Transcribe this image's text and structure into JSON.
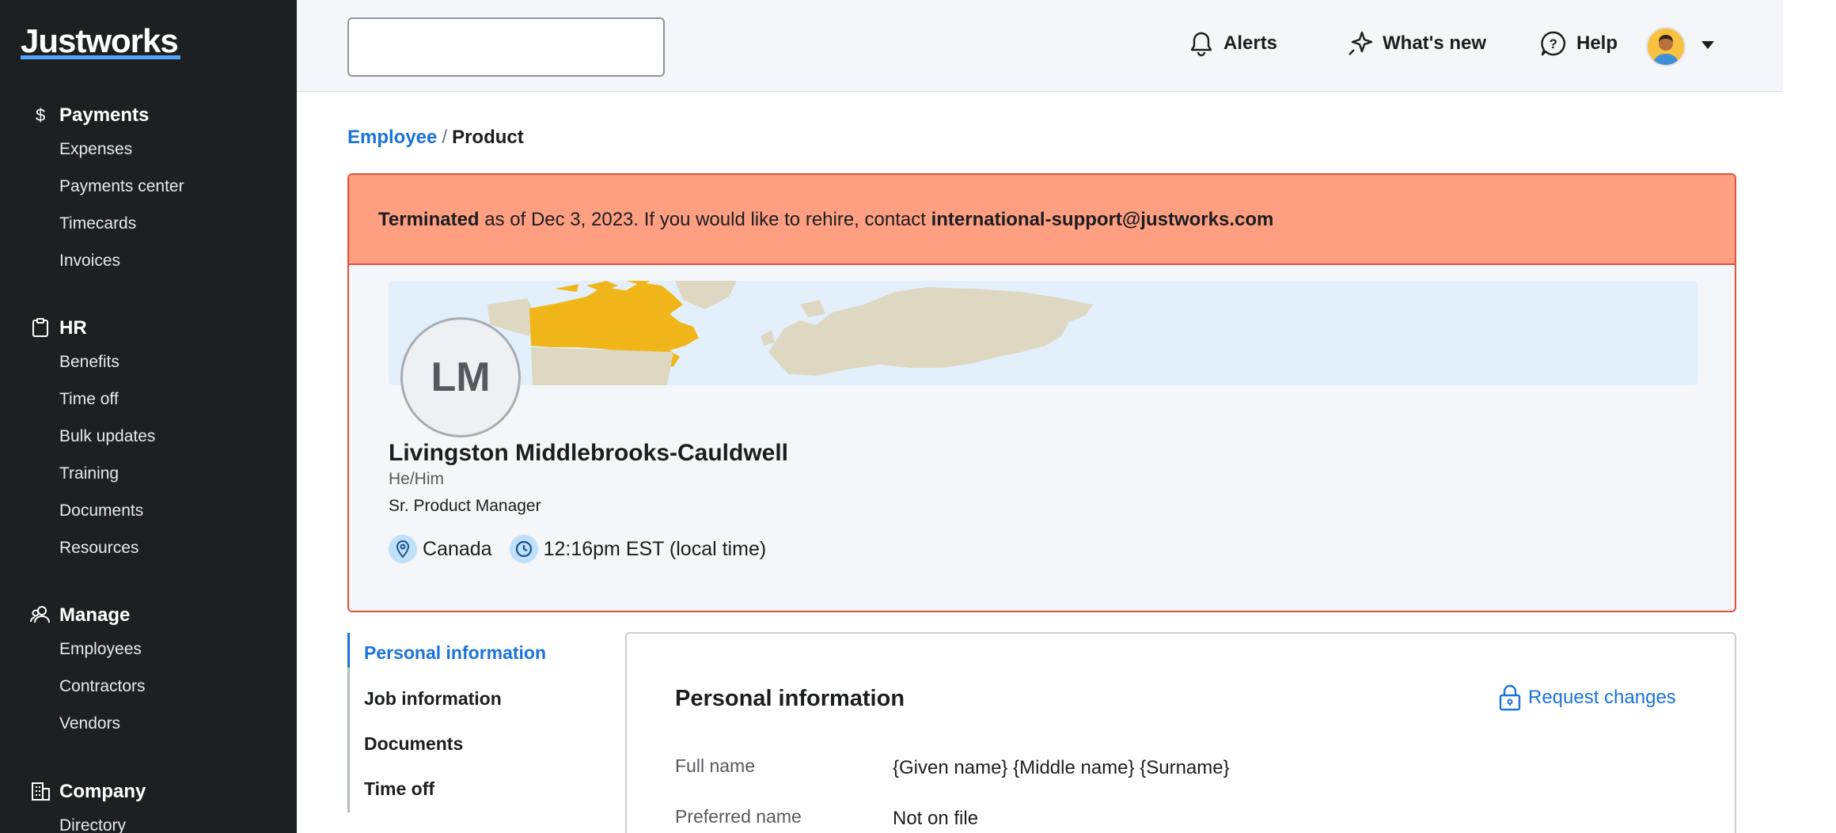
{
  "brand": {
    "logo": "Justworks"
  },
  "sidebar": {
    "groups": [
      {
        "label": "Payments",
        "icon": "dollar-icon",
        "items": [
          "Expenses",
          "Payments center",
          "Timecards",
          "Invoices"
        ]
      },
      {
        "label": "HR",
        "icon": "clipboard-icon",
        "items": [
          "Benefits",
          "Time off",
          "Bulk updates",
          "Training",
          "Documents",
          "Resources"
        ]
      },
      {
        "label": "Manage",
        "icon": "people-icon",
        "items": [
          "Employees",
          "Contractors",
          "Vendors"
        ]
      },
      {
        "label": "Company",
        "icon": "building-icon",
        "items": [
          "Directory"
        ]
      }
    ]
  },
  "topbar": {
    "search": {
      "placeholder": "",
      "value": ""
    },
    "alerts": "Alerts",
    "whats_new": "What's new",
    "help": "Help"
  },
  "breadcrumb": {
    "parent": "Employee",
    "separator": "/",
    "current": "Product"
  },
  "banner": {
    "status": "Terminated",
    "message": " as of Dec 3, 2023. If you would like to rehire, contact ",
    "email": "international-support@justworks.com"
  },
  "profile": {
    "initials": "LM",
    "name": "Livingston Middlebrooks-Cauldwell",
    "pronouns": "He/Him",
    "title": "Sr. Product Manager",
    "country": "Canada",
    "local_time": "12:16pm EST (local time)"
  },
  "subnav": {
    "items": [
      "Personal information",
      "Job information",
      "Documents",
      "Time off"
    ],
    "active": "Personal information"
  },
  "panel": {
    "title": "Personal information",
    "request_changes": "Request changes",
    "fields": [
      {
        "label": "Full name",
        "value": "{Given name} {Middle name} {Surname}"
      },
      {
        "label": "Preferred name",
        "value": "Not on file"
      }
    ]
  },
  "colors": {
    "sidebar_bg": "#1d1f21",
    "link_blue": "#1a73d9",
    "banner_bg": "#fe9f82",
    "banner_border": "#e0533a",
    "map_highlight": "#f0b518"
  }
}
